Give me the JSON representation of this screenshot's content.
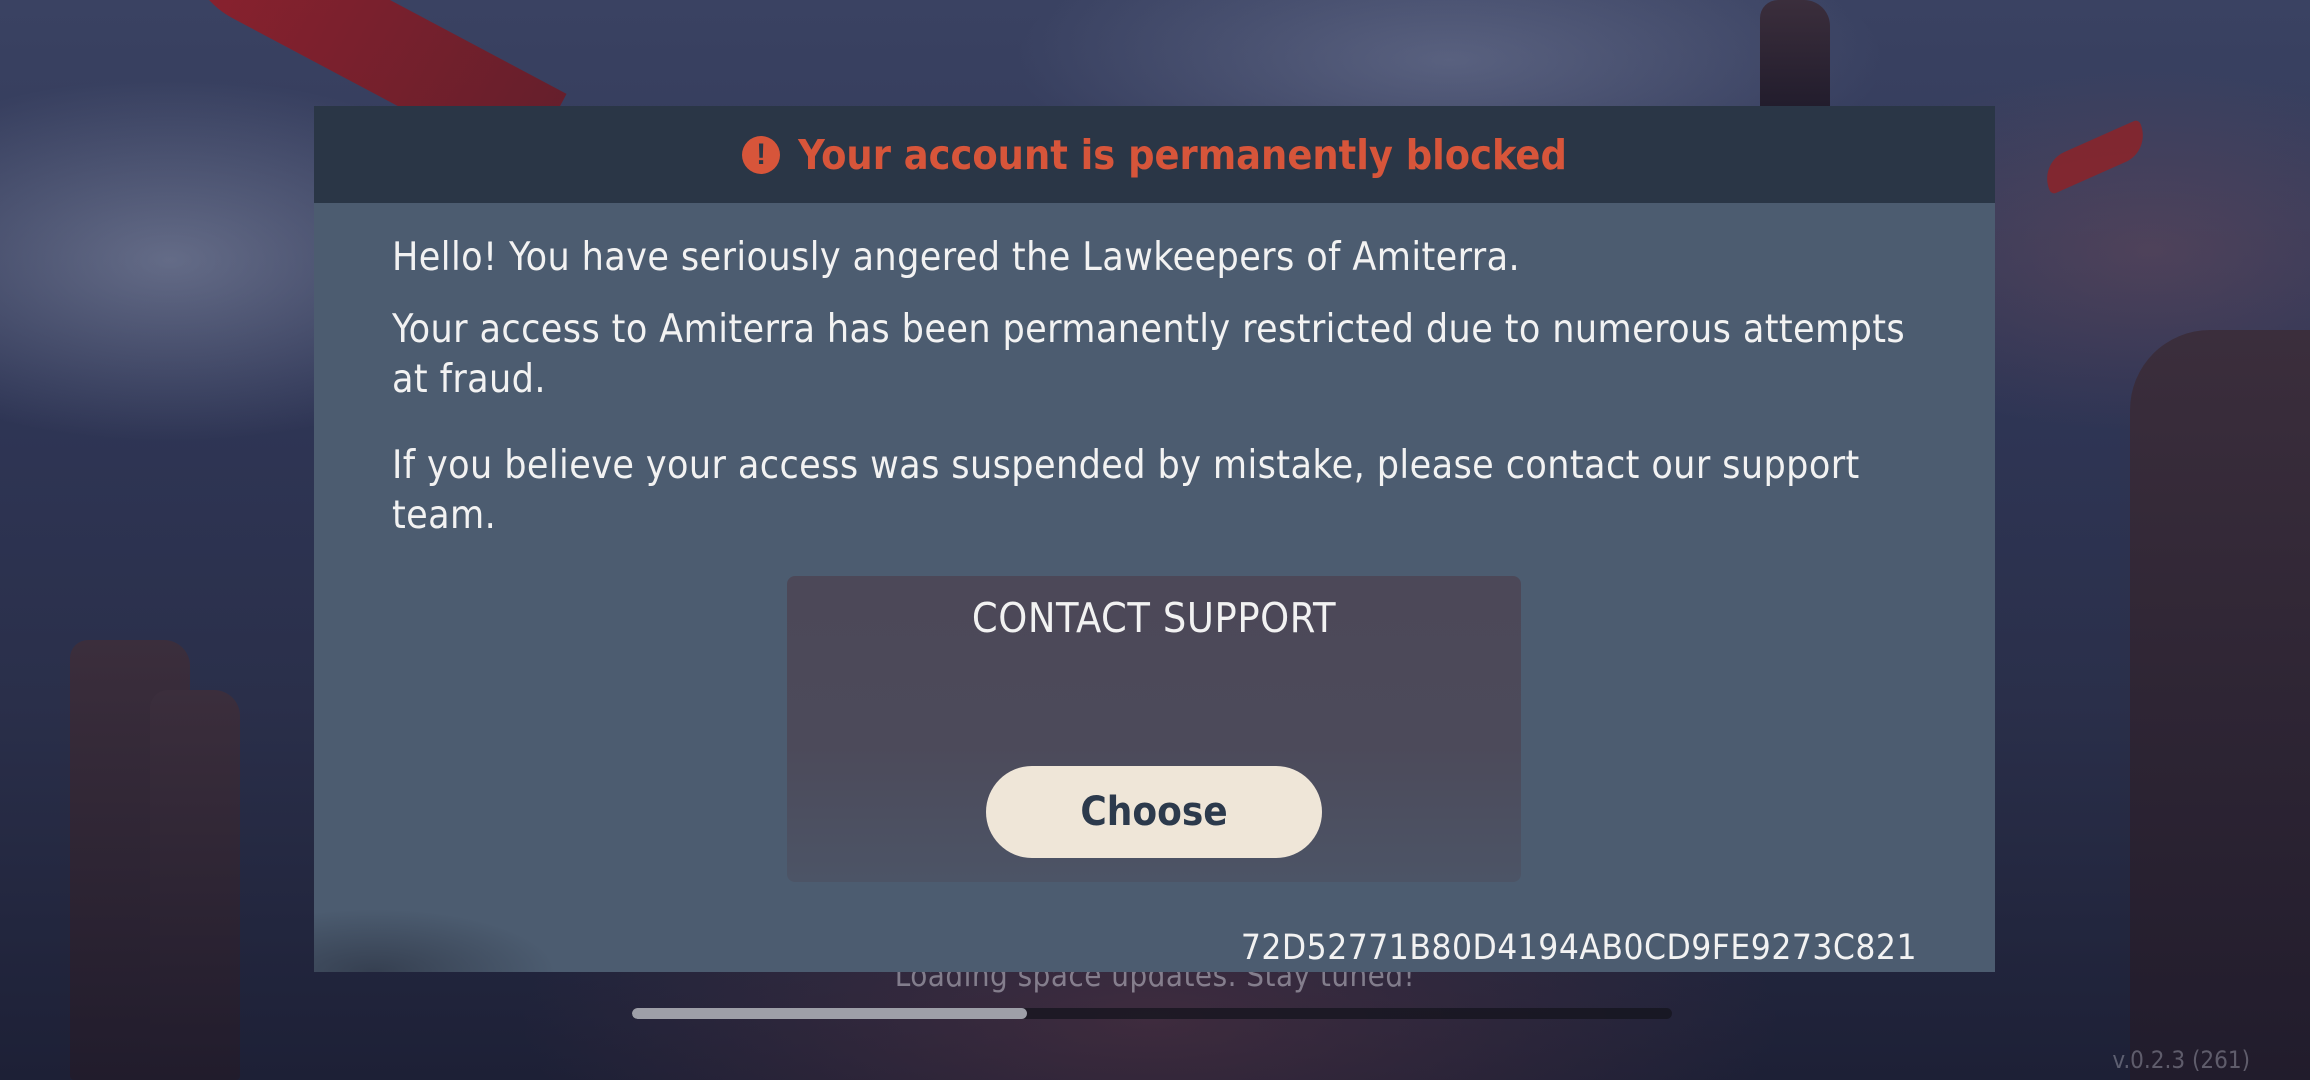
{
  "background": {
    "loading_text": "Loading space updates. Stay tuned!",
    "loading_progress_percent": 38,
    "version": "v.0.2.3 (261)"
  },
  "dialog": {
    "title": "Your account is permanently blocked",
    "icon": "exclamation-circle-icon",
    "paragraphs": [
      "Hello! You have seriously angered the Lawkeepers of Amiterra.",
      "Your access to Amiterra has been permanently restricted due to numerous attempts at fraud.",
      "If you believe your access was suspended by mistake, please contact our support team."
    ],
    "support": {
      "title": "CONTACT SUPPORT",
      "button_label": "Choose"
    },
    "session_id": "72D52771B80D4194AB0CD9FE9273C821"
  },
  "colors": {
    "title_alert": "#d7553a",
    "header_bg": "#2a3646",
    "body_bg": "#4c5c70",
    "button_bg": "#efe6d8",
    "button_text": "#2c3a4c"
  }
}
